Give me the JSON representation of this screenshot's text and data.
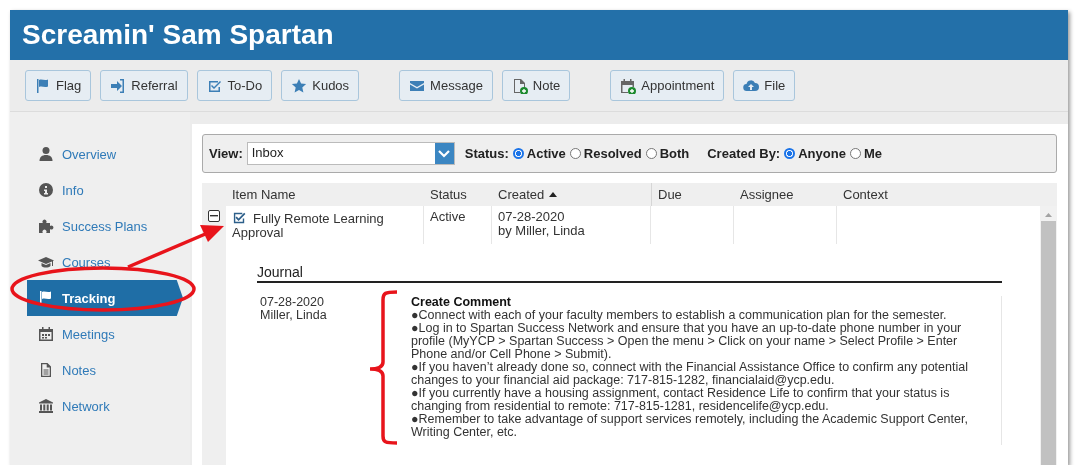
{
  "header": {
    "title": "Screamin' Sam Spartan"
  },
  "toolbar": {
    "groups": [
      [
        {
          "label": "Flag"
        },
        {
          "label": "Referral"
        },
        {
          "label": "To-Do"
        },
        {
          "label": "Kudos"
        }
      ],
      [
        {
          "label": "Message"
        },
        {
          "label": "Note"
        }
      ],
      [
        {
          "label": "Appointment"
        },
        {
          "label": "File"
        }
      ]
    ]
  },
  "sidebar": {
    "items": [
      {
        "label": "Overview",
        "selected": false
      },
      {
        "label": "Info",
        "selected": false
      },
      {
        "label": "Success Plans",
        "selected": false
      },
      {
        "label": "Courses",
        "selected": false
      },
      {
        "label": "Tracking",
        "selected": true
      },
      {
        "label": "Meetings",
        "selected": false
      },
      {
        "label": "Notes",
        "selected": false
      },
      {
        "label": "Network",
        "selected": false
      }
    ]
  },
  "filter": {
    "view_label": "View:",
    "view_value": "Inbox",
    "status_label": "Status:",
    "status_options": [
      {
        "label": "Active",
        "selected": true
      },
      {
        "label": "Resolved",
        "selected": false
      },
      {
        "label": "Both",
        "selected": false
      }
    ],
    "created_by_label": "Created By:",
    "created_by_options": [
      {
        "label": "Anyone",
        "selected": true
      },
      {
        "label": "Me",
        "selected": false
      }
    ]
  },
  "table": {
    "columns": [
      {
        "label": "Item Name"
      },
      {
        "label": "Status"
      },
      {
        "label": "Created",
        "sorted": true
      },
      {
        "label": "Due"
      },
      {
        "label": "Assignee"
      },
      {
        "label": "Context"
      }
    ],
    "rows": [
      {
        "expanded": true,
        "item_name": "Fully Remote Learning Approval",
        "status": "Active",
        "created_date": "07-28-2020",
        "created_by": "by Miller, Linda",
        "journal": {
          "title": "Journal",
          "entries": [
            {
              "date": "07-28-2020",
              "author": "Miller, Linda",
              "heading": "Create Comment",
              "lines": [
                "●Connect with each of your faculty members to establish a communication plan for the semester.",
                "●Log in to Spartan Success Network and ensure that you have an up-to-date phone number in your profile (MyYCP > Spartan Success > Open the menu > Click on your name > Select Profile > Enter Phone and/or Cell Phone > Submit).",
                "●If you haven’t already done so, connect with the Financial Assistance Office to confirm any potential changes to your financial aid package: 717-815-1282, financialaid@ycp.edu.",
                "●If you currently have a housing assignment, contact Residence Life to confirm that your status is changing from residential to remote: 717-815-1281, residencelife@ycp.edu.",
                "●Remember to take advantage of support services remotely, including the Academic Support Center, Writing Center, etc."
              ]
            }
          ]
        }
      }
    ]
  },
  "annotations": [
    {
      "kind": "ellipse"
    },
    {
      "kind": "arrow"
    },
    {
      "kind": "bracket"
    }
  ]
}
